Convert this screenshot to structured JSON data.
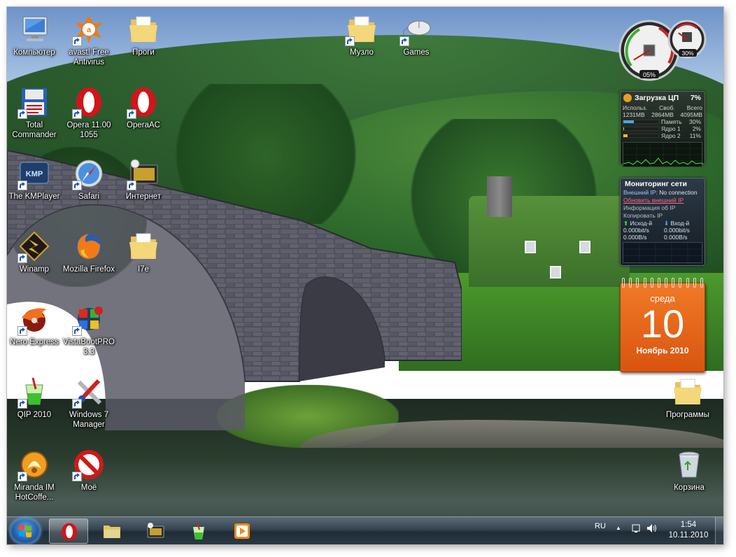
{
  "desktop": {
    "icons": [
      {
        "label": "Компьютер",
        "icon": "computer-icon"
      },
      {
        "label": "avast! Free Antivirus",
        "icon": "avast-icon"
      },
      {
        "label": "Проги",
        "icon": "folder-icon"
      },
      {
        "label": "Музло",
        "icon": "folder-icon"
      },
      {
        "label": "Games",
        "icon": "mouse-icon"
      },
      {
        "label": "Total Commander",
        "icon": "total-commander-icon"
      },
      {
        "label": "Opera 11.00 1055",
        "icon": "opera-icon"
      },
      {
        "label": "OperaAC",
        "icon": "opera-icon"
      },
      {
        "label": "The KMPlayer",
        "icon": "kmplayer-icon"
      },
      {
        "label": "Safari",
        "icon": "safari-icon"
      },
      {
        "label": "Интернет",
        "icon": "internet-icon"
      },
      {
        "label": "Winamp",
        "icon": "winamp-icon"
      },
      {
        "label": "Mozilla Firefox",
        "icon": "firefox-icon"
      },
      {
        "label": "I7e",
        "icon": "folder-icon"
      },
      {
        "label": "Nero Express",
        "icon": "nero-icon"
      },
      {
        "label": "VistaBootPRO 3.3",
        "icon": "vistabootpro-icon"
      },
      {
        "label": "QIP 2010",
        "icon": "qip-icon"
      },
      {
        "label": "Windows 7 Manager",
        "icon": "windows7-manager-icon"
      },
      {
        "label": "Miranda IM HotCoffe...",
        "icon": "miranda-icon"
      },
      {
        "label": "Моё",
        "icon": "no-entry-icon"
      },
      {
        "label": "Программы",
        "icon": "folder-icon"
      },
      {
        "label": "Корзина",
        "icon": "recycle-bin-icon"
      }
    ]
  },
  "gadgets": {
    "cpu_meter": {
      "cpu": "05%",
      "memory": "30%",
      "cpu_value": 0.05,
      "memory_value": 0.3
    },
    "cpu_panel": {
      "title": "Загрузка ЦП",
      "percent": "7%",
      "mem_headers": [
        "Использ.",
        "Своб.",
        "Всего"
      ],
      "mem_values": [
        "1231MB",
        "2864MB",
        "4095MB"
      ],
      "rows": [
        {
          "label": "Память",
          "value": "30%",
          "fraction": 0.3,
          "color": "#4aa6e8"
        },
        {
          "label": "Ядро 1",
          "value": "2%",
          "fraction": 0.02,
          "color": "#e8c020"
        },
        {
          "label": "Ядро 2",
          "value": "11%",
          "fraction": 0.11,
          "color": "#e8c020"
        }
      ]
    },
    "net_monitor": {
      "title": "Мониторинг сети",
      "ext_ip_label": "Внешний IP:",
      "ext_ip_value": "No connection",
      "refresh_link": "Обновить внешний IP",
      "ip_info": "Информация об IP",
      "copy_ip": "Копировать IP",
      "out_label": "Исход-й",
      "in_label": "Вход-й",
      "out_bits": "0.000bit/s",
      "in_bits": "0.000bit/s",
      "out_bytes": "0.000B/s",
      "in_bytes": "0.000B/s"
    },
    "calendar": {
      "weekday": "среда",
      "day": "10",
      "month": "Ноябрь 2010"
    }
  },
  "taskbar": {
    "items": [
      {
        "icon": "opera-icon",
        "active": true
      },
      {
        "icon": "explorer-icon",
        "active": false
      },
      {
        "icon": "internet-icon",
        "active": false
      },
      {
        "icon": "qip-icon",
        "active": false
      },
      {
        "icon": "media-player-icon",
        "active": false
      }
    ],
    "tray": {
      "language": "RU",
      "time": "1:54",
      "date": "10.11.2010"
    }
  },
  "colors": {
    "accent": "#1f5ea8",
    "calendar": "#e8661c"
  }
}
